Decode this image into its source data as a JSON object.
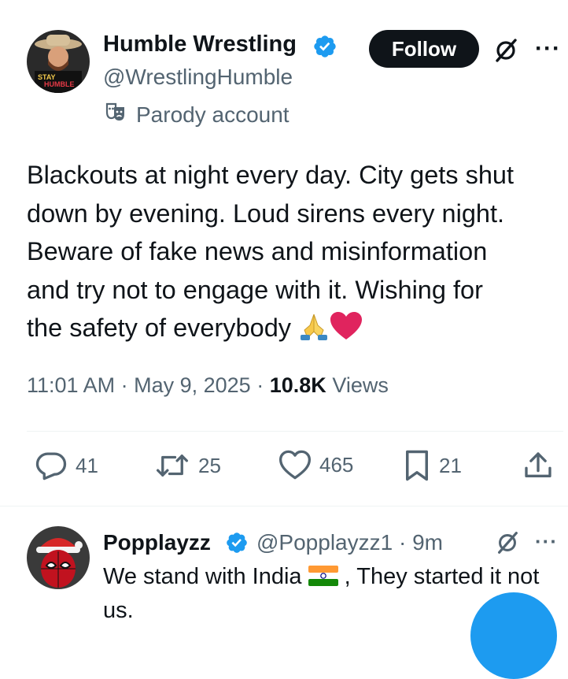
{
  "tweet": {
    "author_name": "Humble Wrestling",
    "author_handle": "@WrestlingHumble",
    "follow_label": "Follow",
    "more_label": "···",
    "parody_label": "Parody account",
    "avatar_text": [
      "STAY",
      "HUMBLE"
    ],
    "text_lines": [
      "Blackouts at night every day. City gets shut",
      "down by evening. Loud sirens every night.",
      "Beware of fake news and misinformation",
      "and try not to engage with it. Wishing for"
    ],
    "text_last_line": "the safety of everybody ",
    "emojis": [
      "folded-hands",
      "red-heart"
    ],
    "time": "11:01 AM",
    "date": "May 9, 2025",
    "separator": "·",
    "views_count": "10.8K",
    "views_label": "Views",
    "replies": "41",
    "reposts": "25",
    "likes": "465",
    "bookmarks": "21"
  },
  "reply": {
    "author_name": "Popplayzz",
    "author_handle": "@Popplayzz1",
    "time_ago": "9m",
    "separator": "·",
    "more_label": "···",
    "text_before_flag": "We stand with India ",
    "flag": "india-flag",
    "text_after_flag": " , They started it not us."
  },
  "colors": {
    "text": "#0f1419",
    "secondary": "#536471",
    "verified_blue": "#1d9bf0",
    "heart_red": "#e0245e",
    "divider": "#eff3f4"
  }
}
